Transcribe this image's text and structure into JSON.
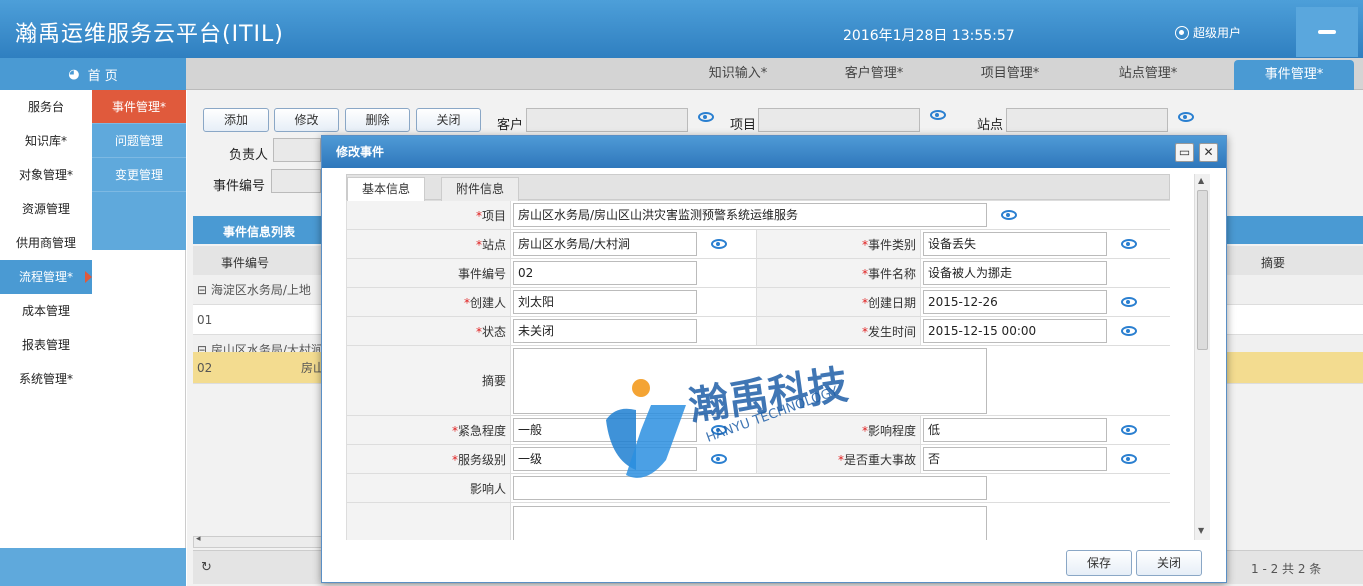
{
  "header": {
    "title": "瀚禹运维服务云平台(ITIL)",
    "datetime": "2016年1月28日 13:55:57",
    "user": "超级用户"
  },
  "topnav": {
    "home": "首 页",
    "tabs": [
      {
        "label": "知识输入*"
      },
      {
        "label": "客户管理*"
      },
      {
        "label": "项目管理*"
      },
      {
        "label": "站点管理*"
      },
      {
        "label": "事件管理*",
        "active": true
      }
    ]
  },
  "sidebar": {
    "items": [
      {
        "label": "服务台"
      },
      {
        "label": "知识库*"
      },
      {
        "label": "对象管理*"
      },
      {
        "label": "资源管理"
      },
      {
        "label": "供用商管理"
      },
      {
        "label": "流程管理*",
        "active": true
      },
      {
        "label": "成本管理"
      },
      {
        "label": "报表管理"
      },
      {
        "label": "系统管理*"
      }
    ],
    "subitems": [
      {
        "label": "事件管理*",
        "active": true
      },
      {
        "label": "问题管理"
      },
      {
        "label": "变更管理"
      }
    ]
  },
  "toolbar": {
    "add": "添加",
    "edit": "修改",
    "delete": "删除",
    "close": "关闭"
  },
  "filters": {
    "customer": "客户",
    "project": "项目",
    "site": "站点",
    "owner": "负责人",
    "event_no": "事件编号"
  },
  "grid": {
    "title": "事件信息列表",
    "col_event_no": "事件编号",
    "col_summary": "摘要",
    "groups": [
      {
        "label": "⊟ 海淀区水务局/上地",
        "rows": [
          {
            "no": "01",
            "text": ""
          }
        ]
      },
      {
        "label": "⊟ 房山区水务局/大村涧",
        "rows": [
          {
            "no": "02",
            "text": "房山"
          }
        ]
      }
    ],
    "pager": "1 - 2  共 2 条"
  },
  "dialog": {
    "title": "修改事件",
    "tabs": [
      "基本信息",
      "附件信息"
    ],
    "labels": {
      "project": "项目",
      "site": "站点",
      "event_type": "事件类别",
      "event_no": "事件编号",
      "event_name": "事件名称",
      "creator": "创建人",
      "create_date": "创建日期",
      "status": "状态",
      "occur_time": "发生时间",
      "summary": "摘要",
      "urgency": "紧急程度",
      "impact": "影响程度",
      "service_level": "服务级别",
      "major": "是否重大事故",
      "affected": "影响人"
    },
    "values": {
      "project": "房山区水务局/房山区山洪灾害监测预警系统运维服务",
      "site": "房山区水务局/大村涧",
      "event_type": "设备丢失",
      "event_no": "02",
      "event_name": "设备被人为挪走",
      "creator": "刘太阳",
      "create_date": "2015-12-26",
      "status": "未关闭",
      "occur_time": "2015-12-15 00:00",
      "summary": "",
      "urgency": "一般",
      "impact": "低",
      "service_level": "一级",
      "major": "否",
      "affected": ""
    },
    "save": "保存",
    "close": "关闭"
  },
  "watermark": {
    "cn": "瀚禹科技",
    "en": "HANYU TECHNOLOGY"
  },
  "colors": {
    "primary": "#4a9ad3",
    "accent": "#e05a3c",
    "selected_row": "#f3dc90"
  }
}
